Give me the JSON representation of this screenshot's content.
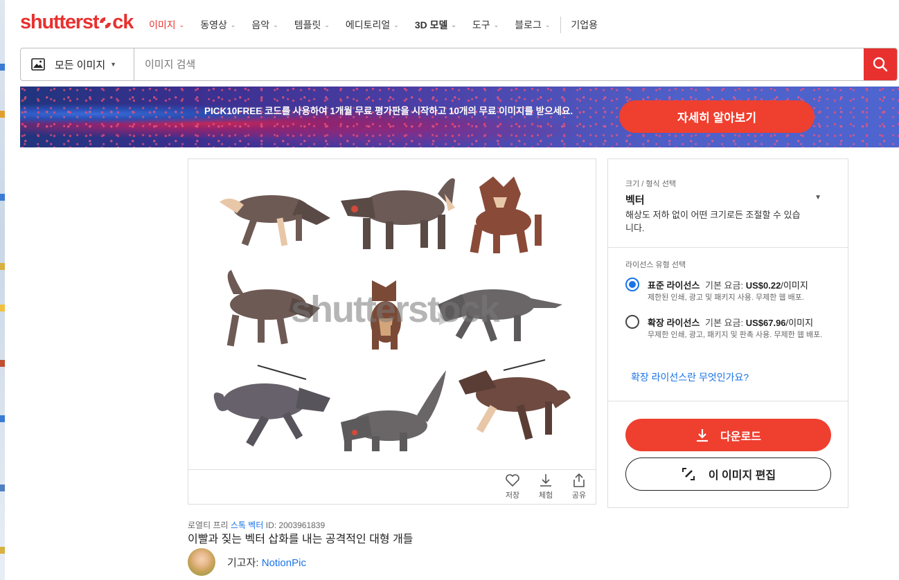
{
  "brand": {
    "logo_text_1": "shutterst",
    "logo_text_2": "ck",
    "accent": "#e8312f"
  },
  "nav": {
    "items": [
      {
        "label": "이미지",
        "active": true
      },
      {
        "label": "동영상"
      },
      {
        "label": "음악"
      },
      {
        "label": "템플릿"
      },
      {
        "label": "에디토리얼"
      },
      {
        "label": "3D 모델"
      },
      {
        "label": "도구"
      },
      {
        "label": "블로그"
      }
    ],
    "enterprise": "기업용"
  },
  "search": {
    "category": "모든 이미지",
    "placeholder": "이미지 검색"
  },
  "banner": {
    "text": "PICK10FREE 코드를 사용하여 1개월 무료 평가판을 시작하고 10개의 무료 이미지를 받으세요.",
    "button": "자세히 알아보기"
  },
  "image": {
    "watermark": "shutterstock",
    "actions": {
      "save": "저장",
      "try": "체험",
      "share": "공유"
    }
  },
  "format": {
    "label": "크기 / 형식 선택",
    "value": "벡터",
    "desc": "해상도 저하 없이 어떤 크기로든 조절할 수 있습니다."
  },
  "license": {
    "label": "라이선스 유형 선택",
    "standard": {
      "name": "표준 라이선스",
      "price_label": "기본 요금:",
      "price": "US$0.22",
      "unit": "/이미지",
      "desc": "제한된 인쇄, 광고 및 패키지 사용. 무제한 웹 배포.",
      "selected": true
    },
    "enhanced": {
      "name": "확장 라이선스",
      "price_label": "기본 요금:",
      "price": "US$67.96",
      "unit": "/이미지",
      "desc": "무제한 인쇄, 광고, 패키지 및 판촉 사용. 무제한 웹 배포.",
      "selected": false
    },
    "link": "확장 라이선스란 무엇인가요?"
  },
  "buttons": {
    "download": "다운로드",
    "edit": "이 이미지 편집"
  },
  "meta": {
    "royalty_free": "로열티 프리",
    "stock_vector": "스톡 벡터",
    "id": "ID: 2003961839",
    "title": "이빨과 짖는 벡터 삽화를 내는 공격적인 대형 개들",
    "contributor_label": "기고자:",
    "contributor": "NotionPic"
  }
}
